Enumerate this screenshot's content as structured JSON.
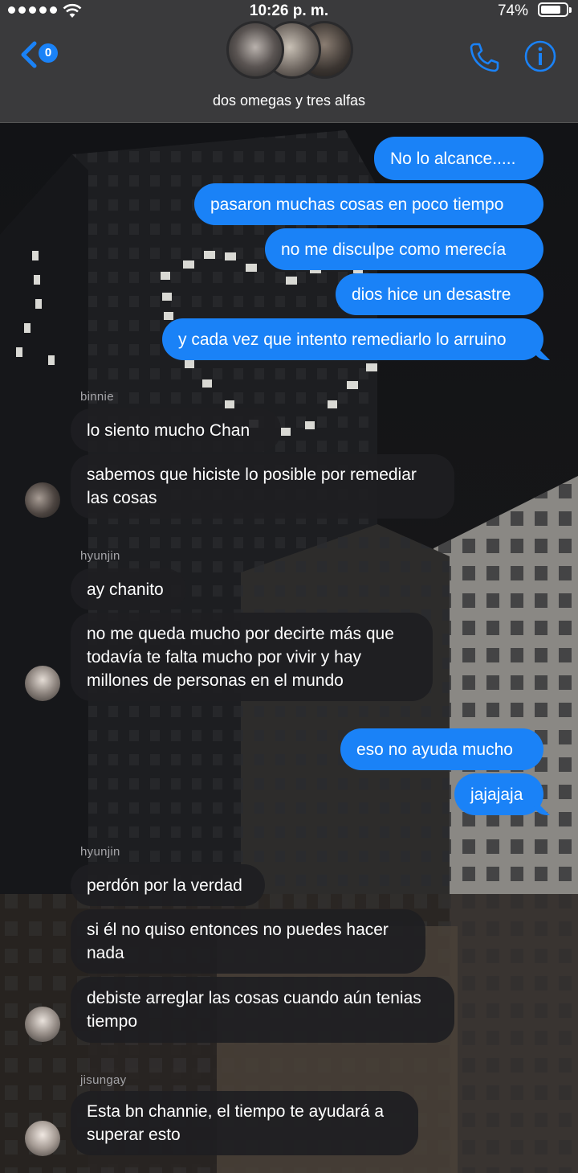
{
  "status_bar": {
    "time": "10:26 p. m.",
    "battery": "74%"
  },
  "header": {
    "unread_count": "0",
    "group_name": "dos omegas y tres alfas"
  },
  "colors": {
    "outgoing": "#1a82f7",
    "incoming": "#1e1e22",
    "header": "#3a3a3c",
    "accent": "#1a82f7"
  },
  "icons": [
    "back-chevron-icon",
    "phone-icon",
    "info-icon",
    "wifi-icon",
    "battery-icon"
  ],
  "messages": [
    {
      "text": "No lo alcance....."
    },
    {
      "text": "pasaron muchas cosas en poco tiempo"
    },
    {
      "text": "no me disculpe como merecía"
    },
    {
      "text": "dios hice un desastre"
    },
    {
      "text": "y cada vez que intento remediarlo lo arruino"
    },
    {
      "sender": "binnie",
      "text": "lo siento mucho Chan"
    },
    {
      "text": "sabemos que hiciste lo posible por remediar las cosas"
    },
    {
      "sender": "hyunjin",
      "text": "ay chanito"
    },
    {
      "text": "no me queda mucho por decirte más que todavía te falta mucho por vivir y hay millones de personas en el mundo"
    },
    {
      "text": "eso no ayuda mucho"
    },
    {
      "text": "jajajaja"
    },
    {
      "sender": "hyunjin",
      "text": "perdón por la verdad"
    },
    {
      "text": "si él no quiso entonces no puedes hacer nada"
    },
    {
      "text": "debiste arreglar las cosas cuando aún tenias tiempo"
    },
    {
      "sender": "jisungay",
      "text": "Esta bn channie, el tiempo te ayudará a superar esto"
    }
  ]
}
